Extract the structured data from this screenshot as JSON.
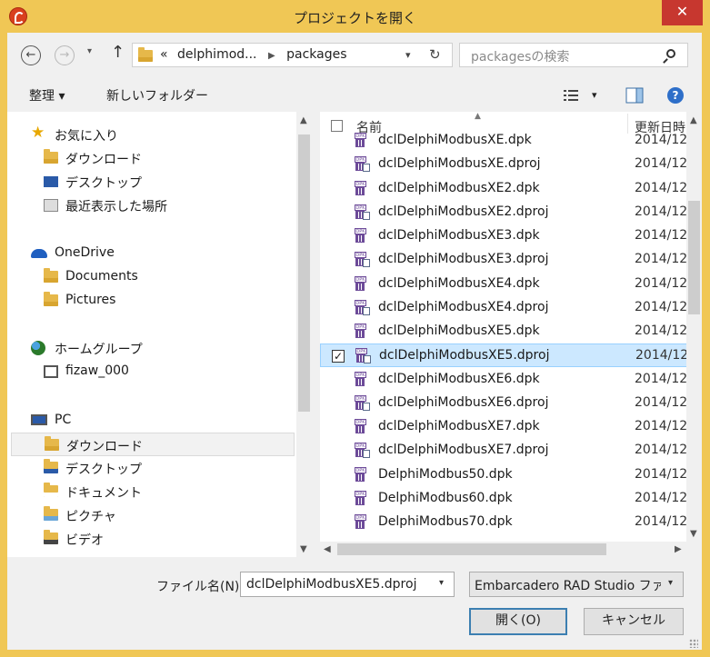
{
  "window": {
    "title": "プロジェクトを開く",
    "close_label": "✕"
  },
  "nav": {
    "back": "←",
    "forward": "→",
    "dropdown": "▾",
    "up": "↑",
    "address_overflow": "«",
    "breadcrumb": [
      "delphimod...",
      "packages"
    ],
    "refresh": "↻",
    "search_placeholder": "packagesの検索"
  },
  "toolbar": {
    "organize": "整理 ▾",
    "new_folder": "新しいフォルダー",
    "view_dropdown": "▾",
    "help": "?"
  },
  "nav_pane": {
    "favorites": [
      {
        "label": "お気に入り",
        "icon": "star-icon"
      },
      {
        "label": "ダウンロード",
        "icon": "download-folder-icon"
      },
      {
        "label": "デスクトップ",
        "icon": "desktop-icon"
      },
      {
        "label": "最近表示した場所",
        "icon": "recent-places-icon"
      }
    ],
    "onedrive": [
      {
        "label": "OneDrive",
        "icon": "cloud-icon"
      },
      {
        "label": "Documents",
        "icon": "folder-icon"
      },
      {
        "label": "Pictures",
        "icon": "folder-icon"
      }
    ],
    "homegroup": [
      {
        "label": "ホームグループ",
        "icon": "homegroup-icon"
      },
      {
        "label": "fizaw_000",
        "icon": "user-icon"
      }
    ],
    "pc": [
      {
        "label": "PC",
        "icon": "computer-icon"
      },
      {
        "label": "ダウンロード",
        "icon": "download-folder-icon"
      },
      {
        "label": "デスクトップ",
        "icon": "desktop-folder-icon"
      },
      {
        "label": "ドキュメント",
        "icon": "documents-folder-icon"
      },
      {
        "label": "ピクチャ",
        "icon": "pictures-folder-icon"
      },
      {
        "label": "ビデオ",
        "icon": "videos-folder-icon"
      }
    ]
  },
  "file_list": {
    "columns": {
      "name": "名前",
      "date": "更新日時"
    },
    "files": [
      {
        "name": "dclDelphiModbusXE.dpk",
        "date": "2014/12"
      },
      {
        "name": "dclDelphiModbusXE.dproj",
        "date": "2014/12"
      },
      {
        "name": "dclDelphiModbusXE2.dpk",
        "date": "2014/12"
      },
      {
        "name": "dclDelphiModbusXE2.dproj",
        "date": "2014/12"
      },
      {
        "name": "dclDelphiModbusXE3.dpk",
        "date": "2014/12"
      },
      {
        "name": "dclDelphiModbusXE3.dproj",
        "date": "2014/12"
      },
      {
        "name": "dclDelphiModbusXE4.dpk",
        "date": "2014/12"
      },
      {
        "name": "dclDelphiModbusXE4.dproj",
        "date": "2014/12"
      },
      {
        "name": "dclDelphiModbusXE5.dpk",
        "date": "2014/12"
      },
      {
        "name": "dclDelphiModbusXE5.dproj",
        "date": "2014/12",
        "selected": true
      },
      {
        "name": "dclDelphiModbusXE6.dpk",
        "date": "2014/12"
      },
      {
        "name": "dclDelphiModbusXE6.dproj",
        "date": "2014/12"
      },
      {
        "name": "dclDelphiModbusXE7.dpk",
        "date": "2014/12"
      },
      {
        "name": "dclDelphiModbusXE7.dproj",
        "date": "2014/12"
      },
      {
        "name": "DelphiModbus50.dpk",
        "date": "2014/12"
      },
      {
        "name": "DelphiModbus60.dpk",
        "date": "2014/12"
      },
      {
        "name": "DelphiModbus70.dpk",
        "date": "2014/12"
      }
    ]
  },
  "footer": {
    "filename_label": "ファイル名(N):",
    "filename_value": "dclDelphiModbusXE5.dproj",
    "filetype_value": "Embarcadero RAD Studio ファイル",
    "open_button": "開く(O)",
    "cancel_button": "キャンセル"
  },
  "colors": {
    "frame": "#f0c755",
    "close": "#c7372f",
    "selection": "#cce8ff"
  }
}
